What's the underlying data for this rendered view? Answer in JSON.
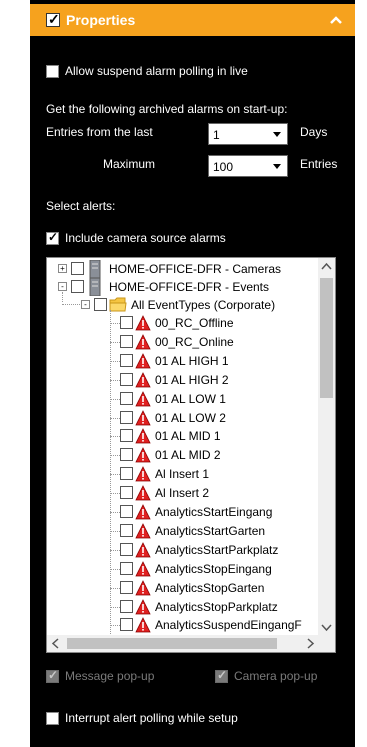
{
  "header": {
    "title": "Properties",
    "checked": true
  },
  "allow_suspend": {
    "label": "Allow suspend alarm polling in live",
    "checked": false
  },
  "archived_heading": "Get the following archived alarms on start-up:",
  "entries_from": {
    "label": "Entries from the last",
    "value": "1",
    "unit": "Days"
  },
  "maximum": {
    "label": "Maximum",
    "value": "100",
    "unit": "Entries"
  },
  "select_alerts": "Select alerts:",
  "include_camera": {
    "label": "Include camera source alarms",
    "checked": true
  },
  "tree": {
    "nodes": [
      {
        "label": "HOME-OFFICE-DFR - Cameras",
        "expander": "+",
        "icon": "server-icon"
      },
      {
        "label": "HOME-OFFICE-DFR - Events",
        "expander": "-",
        "icon": "server-icon"
      },
      {
        "label": "All EventTypes (Corporate)",
        "expander": "-",
        "icon": "folder-icon"
      }
    ],
    "alerts": [
      "00_RC_Offline",
      "00_RC_Online",
      "01 AL HIGH 1",
      "01 AL HIGH 2",
      "01 AL LOW 1",
      "01 AL LOW 2",
      "01 AL MID 1",
      "01 AL MID 2",
      "Al Insert 1",
      "Al Insert 2",
      "AnalyticsStartEingang",
      "AnalyticsStartGarten",
      "AnalyticsStartParkplatz",
      "AnalyticsStopEingang",
      "AnalyticsStopGarten",
      "AnalyticsStopParkplatz",
      "AnalyticsSuspendEingangF"
    ]
  },
  "message_popup": {
    "label": "Message pop-up",
    "checked": true,
    "enabled": false
  },
  "camera_popup": {
    "label": "Camera pop-up",
    "checked": true,
    "enabled": false
  },
  "interrupt": {
    "label": "Interrupt alert polling while setup",
    "checked": false
  },
  "colors": {
    "accent": "#f6a21e",
    "background": "#000000",
    "alarm_icon": "#e02020",
    "folder_icon": "#f5c542"
  }
}
